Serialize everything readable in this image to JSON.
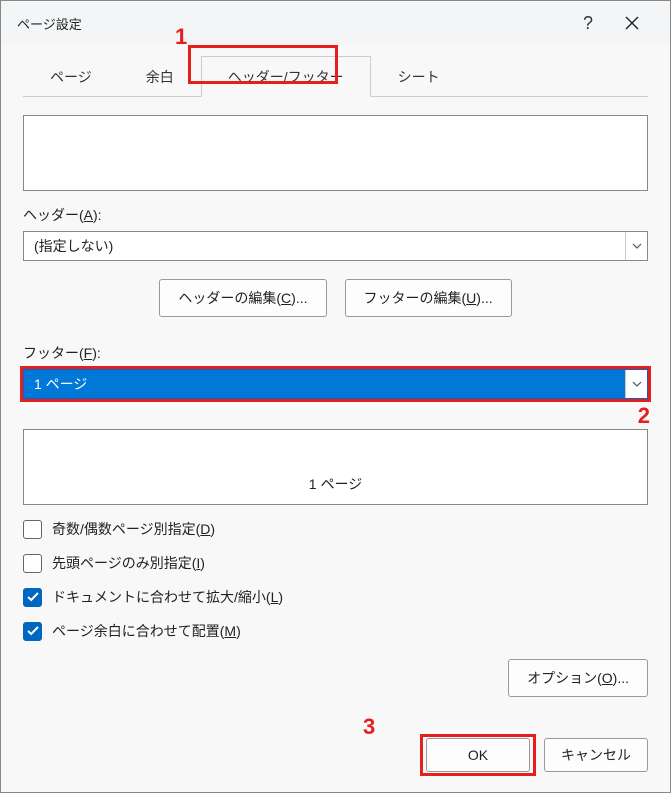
{
  "titlebar": {
    "title": "ページ設定",
    "help": "?",
    "close": "✕"
  },
  "tabs": {
    "page": "ページ",
    "margins": "余白",
    "header_footer": "ヘッダー/フッター",
    "sheet": "シート"
  },
  "header": {
    "label_pre": "ヘッダー(",
    "label_key": "A",
    "label_post": "):",
    "value": "(指定しない)"
  },
  "buttons": {
    "edit_header_pre": "ヘッダーの編集(",
    "edit_header_key": "C",
    "edit_header_post": ")...",
    "edit_footer_pre": "フッターの編集(",
    "edit_footer_key": "U",
    "edit_footer_post": ")..."
  },
  "footer": {
    "label_pre": "フッター(",
    "label_key": "F",
    "label_post": "):",
    "value": "1 ページ",
    "preview": "1 ページ"
  },
  "checks": {
    "odd_even_pre": "奇数/偶数ページ別指定(",
    "odd_even_key": "D",
    "odd_even_post": ")",
    "first_page_pre": "先頭ページのみ別指定(",
    "first_page_key": "I",
    "first_page_post": ")",
    "scale_doc_pre": "ドキュメントに合わせて拡大/縮小(",
    "scale_doc_key": "L",
    "scale_doc_post": ")",
    "align_margin_pre": "ページ余白に合わせて配置(",
    "align_margin_key": "M",
    "align_margin_post": ")"
  },
  "options_btn_pre": "オプション(",
  "options_btn_key": "O",
  "options_btn_post": ")...",
  "ok": "OK",
  "cancel": "キャンセル",
  "annotations": {
    "n1": "1",
    "n2": "2",
    "n3": "3"
  }
}
